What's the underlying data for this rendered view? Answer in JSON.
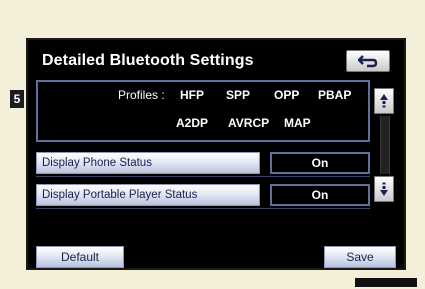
{
  "step_marker": "5",
  "screen": {
    "title": "Detailed Bluetooth Settings",
    "back_icon": "back-arrow-icon",
    "profiles": {
      "label": "Profiles :",
      "row1": [
        "HFP",
        "SPP",
        "OPP",
        "PBAP"
      ],
      "row2": [
        "A2DP",
        "AVRCP",
        "MAP"
      ]
    },
    "settings": [
      {
        "label": "Display Phone Status",
        "value": "On"
      },
      {
        "label": "Display Portable Player Status",
        "value": "On"
      }
    ],
    "scroll_up_icon": "scroll-up-icon",
    "scroll_down_icon": "scroll-down-icon",
    "default_label": "Default",
    "save_label": "Save"
  },
  "colors": {
    "background": "#f3efd9",
    "screen": "#000000",
    "accent_border": "#5d6f9c",
    "button_text": "#1a2050"
  }
}
